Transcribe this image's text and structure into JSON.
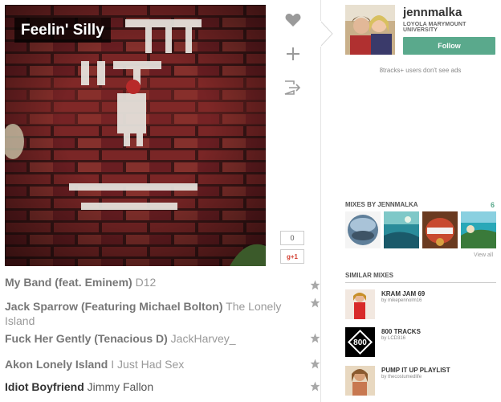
{
  "mix": {
    "title": "Feelin' Silly"
  },
  "share": {
    "count": "0",
    "gplus_label": "g+1"
  },
  "tracks": [
    {
      "name": "My Band (feat. Eminem)",
      "artist": "D12"
    },
    {
      "name": "Jack Sparrow (Featuring Michael Bolton)",
      "artist": "The Lonely Island"
    },
    {
      "name": "Fuck Her Gently (Tenacious D)",
      "artist": "JackHarvey_"
    },
    {
      "name": "Akon Lonely Island",
      "artist": "I Just Had Sex"
    },
    {
      "name": "Idiot Boyfriend",
      "artist": "Jimmy Fallon"
    }
  ],
  "user": {
    "username": "jennmalka",
    "school": "LOYOLA MARYMOUNT UNIVERSITY",
    "follow_label": "Follow",
    "ads_note": "8tracks+ users don't see ads"
  },
  "mixes_by": {
    "heading": "MIXES BY JENNMALKA",
    "count": "6",
    "view_all": "View all"
  },
  "similar": {
    "heading": "SIMILAR MIXES",
    "items": [
      {
        "title": "KRAM JAM 69",
        "by": "by mikepennolm16"
      },
      {
        "title": "800 TRACKS",
        "by": "by LCD316",
        "thumb_text": "800"
      },
      {
        "title": "PUMP IT UP PLAYLIST",
        "by": "by thecostumedlife"
      }
    ]
  },
  "colors": {
    "accent": "#5aa98c",
    "icon": "#9a9a9a"
  }
}
